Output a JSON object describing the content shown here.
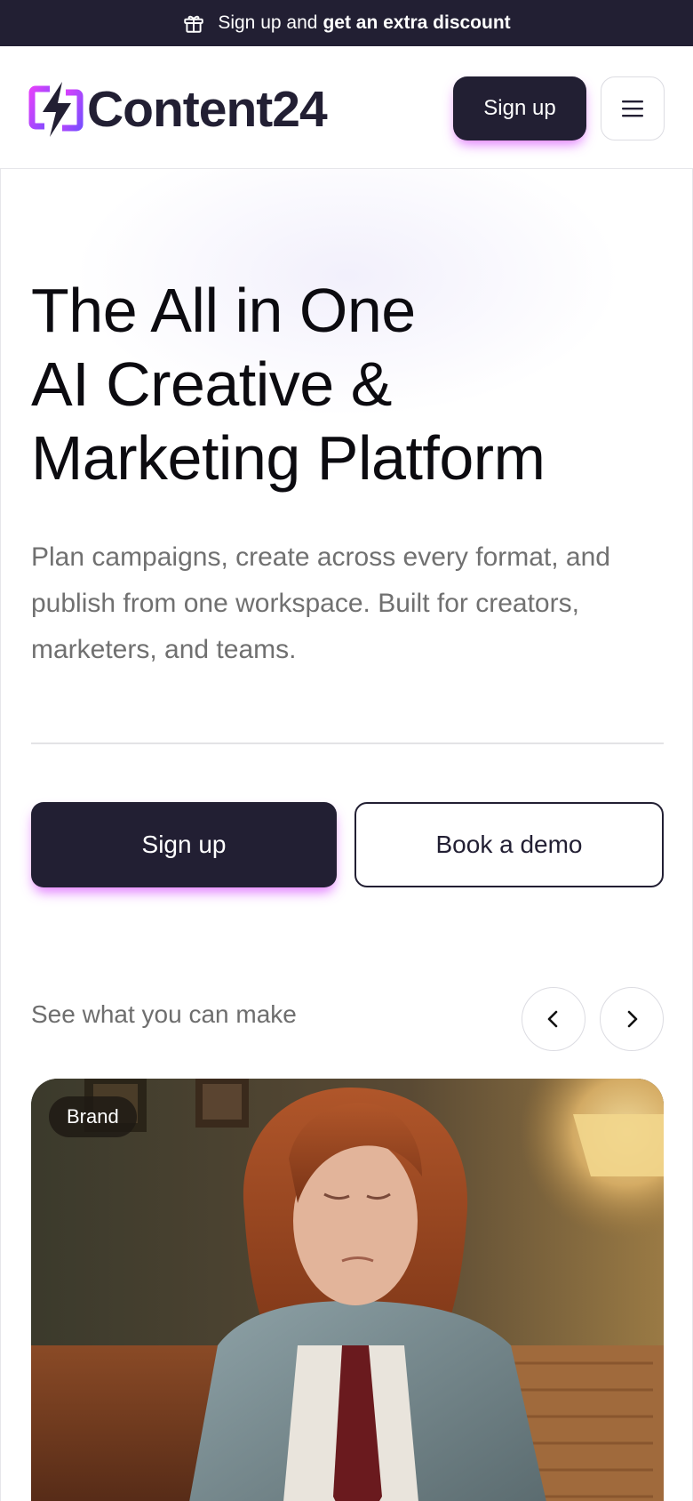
{
  "promo": {
    "lead_text": "Sign up and",
    "strong_text": "get an extra discount",
    "icon": "gift-icon"
  },
  "header": {
    "logo_text": "Content24",
    "signup_label": "Sign up",
    "menu_icon": "hamburger-menu-icon",
    "brand_colors": {
      "dark": "#221f33",
      "accent_pink": "#e040fb",
      "accent_purple": "#7c4dff",
      "accent_glow": "#d64aff"
    }
  },
  "hero": {
    "title_lines": [
      "The All in One",
      "AI Creative &",
      "Marketing Platform"
    ],
    "subtitle": "Plan campaigns, create across every format, and publish from one workspace. Built for creators, marketers, and teams.",
    "primary_cta": "Sign up",
    "secondary_cta": "Book a demo"
  },
  "gallery": {
    "label": "See what you can make",
    "prev_icon": "chevron-left-icon",
    "next_icon": "chevron-right-icon",
    "card": {
      "badge": "Brand"
    }
  }
}
